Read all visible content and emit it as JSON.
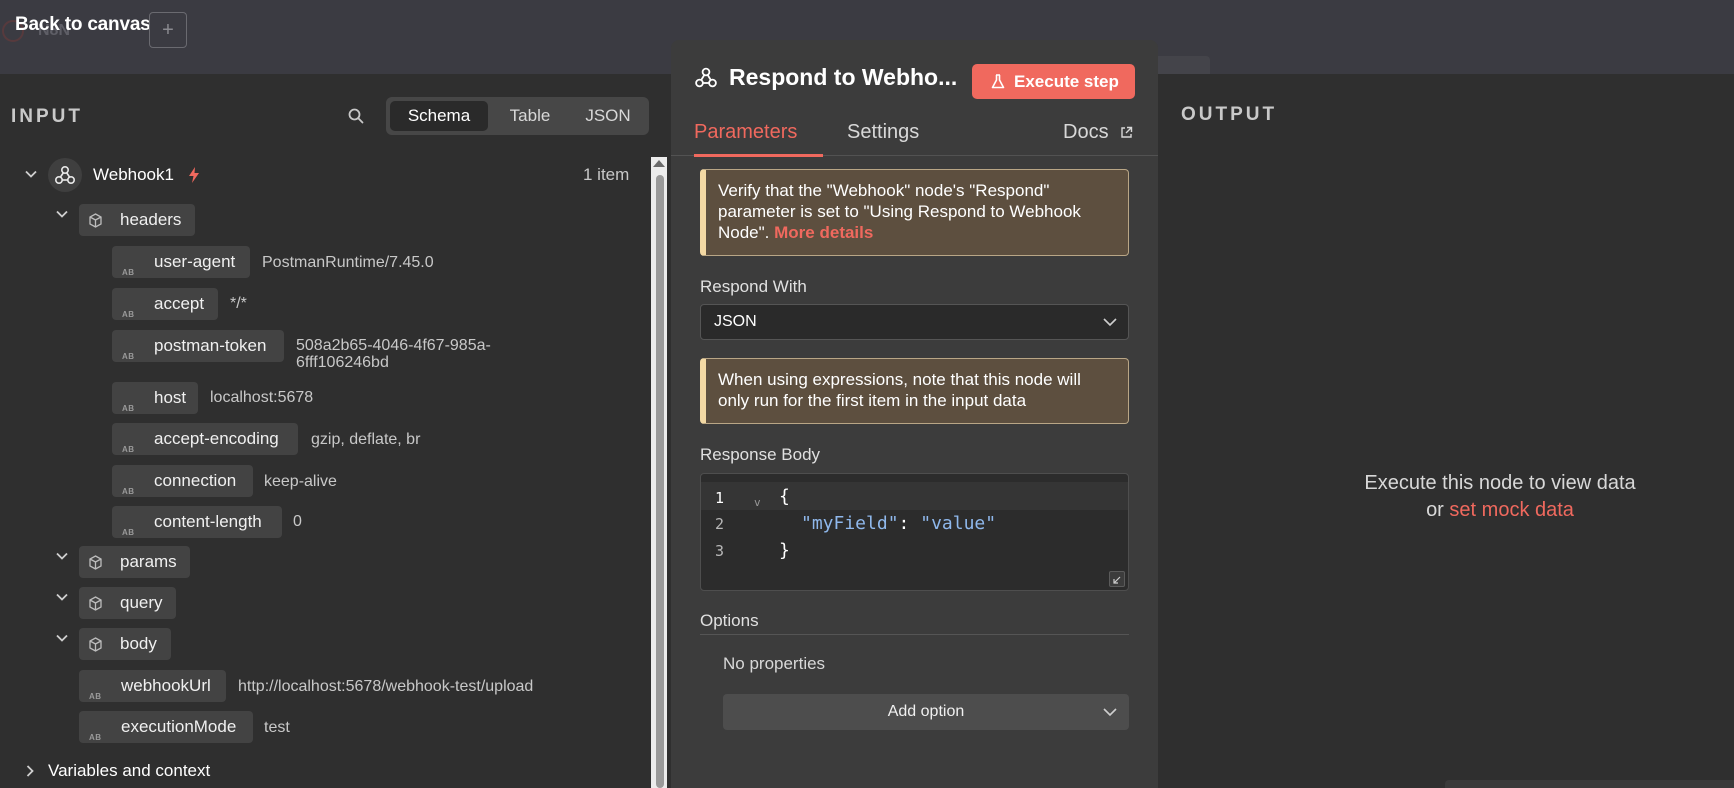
{
  "topbar": {
    "back_label": "Back to canvas",
    "plus_label": "+",
    "ghost_text": "N8N"
  },
  "input": {
    "title": "INPUT",
    "views": [
      "Schema",
      "Table",
      "JSON"
    ],
    "selected_view": "Schema",
    "node": {
      "name": "Webhook1",
      "count": "1 item"
    },
    "headers_label": "headers",
    "headers": [
      {
        "key": "user-agent",
        "value": "PostmanRuntime/7.45.0"
      },
      {
        "key": "accept",
        "value": "*/*"
      },
      {
        "key": "postman-token",
        "value": "508a2b65-4046-4f67-985a-",
        "value2": "6fff106246bd"
      },
      {
        "key": "host",
        "value": "localhost:5678"
      },
      {
        "key": "accept-encoding",
        "value": "gzip, deflate, br"
      },
      {
        "key": "connection",
        "value": "keep-alive"
      },
      {
        "key": "content-length",
        "value": "0"
      }
    ],
    "params_label": "params",
    "query_label": "query",
    "body_label": "body",
    "fields": [
      {
        "key": "webhookUrl",
        "value": "http://localhost:5678/webhook-test/upload"
      },
      {
        "key": "executionMode",
        "value": "test"
      }
    ],
    "variables_label": "Variables and context",
    "type_badge": "AB"
  },
  "params": {
    "title": "Respond to Webho...",
    "execute_label": "Execute step",
    "tabs": {
      "parameters": "Parameters",
      "settings": "Settings",
      "docs": "Docs"
    },
    "note1": "Verify that the \"Webhook\" node's \"Respond\" parameter is set to \"Using Respond to Webhook Node\".",
    "note1_link": "More details",
    "respond_with_label": "Respond With",
    "respond_with_value": "JSON",
    "note2": "When using expressions, note that this node will only run for the first item in the input data",
    "response_body_label": "Response Body",
    "code": {
      "line1": "{",
      "line2_key": "\"myField\"",
      "line2_sep": ": ",
      "line2_val": "\"value\"",
      "line3": "}",
      "ln1": "1",
      "ln2": "2",
      "ln3": "3"
    },
    "options_label": "Options",
    "no_props": "No properties",
    "add_option": "Add option"
  },
  "output": {
    "title": "OUTPUT",
    "msg1": "Execute this node to view data",
    "msg_or": "or",
    "mock_link": "set mock data"
  },
  "colors": {
    "accent": "#f0695e",
    "note_bg": "#5d4f3f",
    "note_border": "#f3d9a4"
  }
}
